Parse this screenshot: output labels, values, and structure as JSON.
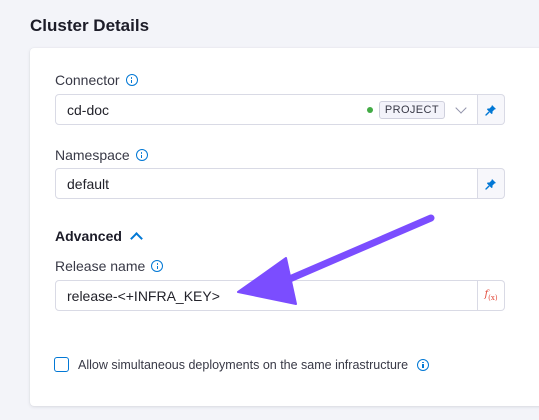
{
  "section": {
    "title": "Cluster Details"
  },
  "connector": {
    "label": "Connector",
    "value": "cd-doc",
    "scope_badge": "PROJECT",
    "status_color": "#42ab45"
  },
  "namespace": {
    "label": "Namespace",
    "value": "default"
  },
  "advanced": {
    "label": "Advanced",
    "expanded": true
  },
  "release_name": {
    "label": "Release name",
    "value": "release-<+INFRA_KEY>"
  },
  "simultaneous": {
    "label": "Allow simultaneous deployments on the same infrastructure",
    "checked": false
  },
  "colors": {
    "accent": "#0278d5",
    "annotation_arrow": "#7b4dff",
    "expression_icon": "#e24a3b"
  },
  "icons": {
    "info": "info-icon",
    "pin": "pin-icon",
    "expression": "fx-icon",
    "dropdown": "chevron-down-icon",
    "collapse": "chevron-up-icon"
  }
}
